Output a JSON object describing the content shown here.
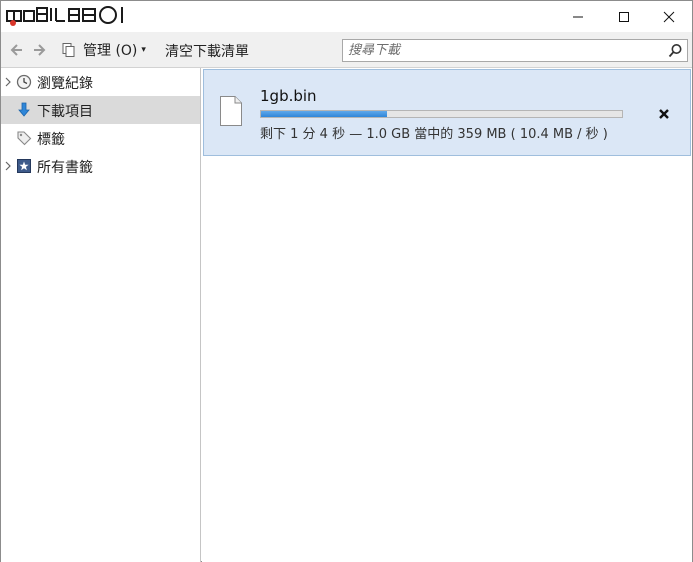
{
  "window": {
    "logo_text": "mobile01",
    "controls": {
      "minimize": "minimize",
      "maximize": "maximize",
      "close": "close"
    }
  },
  "toolbar": {
    "back_icon": "back-arrow-icon",
    "forward_icon": "forward-arrow-icon",
    "organize_label": "管理 (O)",
    "clear_label": "清空下載清單",
    "search_placeholder": "搜尋下載"
  },
  "sidebar": {
    "items": [
      {
        "label": "瀏覽紀錄",
        "icon": "history-clock-icon",
        "expandable": true,
        "selected": false
      },
      {
        "label": "下載項目",
        "icon": "download-arrow-icon",
        "expandable": false,
        "selected": true
      },
      {
        "label": "標籤",
        "icon": "tag-icon",
        "expandable": false,
        "selected": false
      },
      {
        "label": "所有書籤",
        "icon": "bookmarks-star-icon",
        "expandable": true,
        "selected": false
      }
    ]
  },
  "downloads": [
    {
      "filename": "1gb.bin",
      "progress_fraction": 0.35,
      "status": "剩下 1 分 4 秒 — 1.0 GB 當中的 359 MB ( 10.4 MB / 秒 )"
    }
  ],
  "colors": {
    "selected_row": "#dbe7f6",
    "selected_border": "#9fbedd",
    "progress_fill": "#2f86d8",
    "sidebar_selected": "#dadada"
  }
}
